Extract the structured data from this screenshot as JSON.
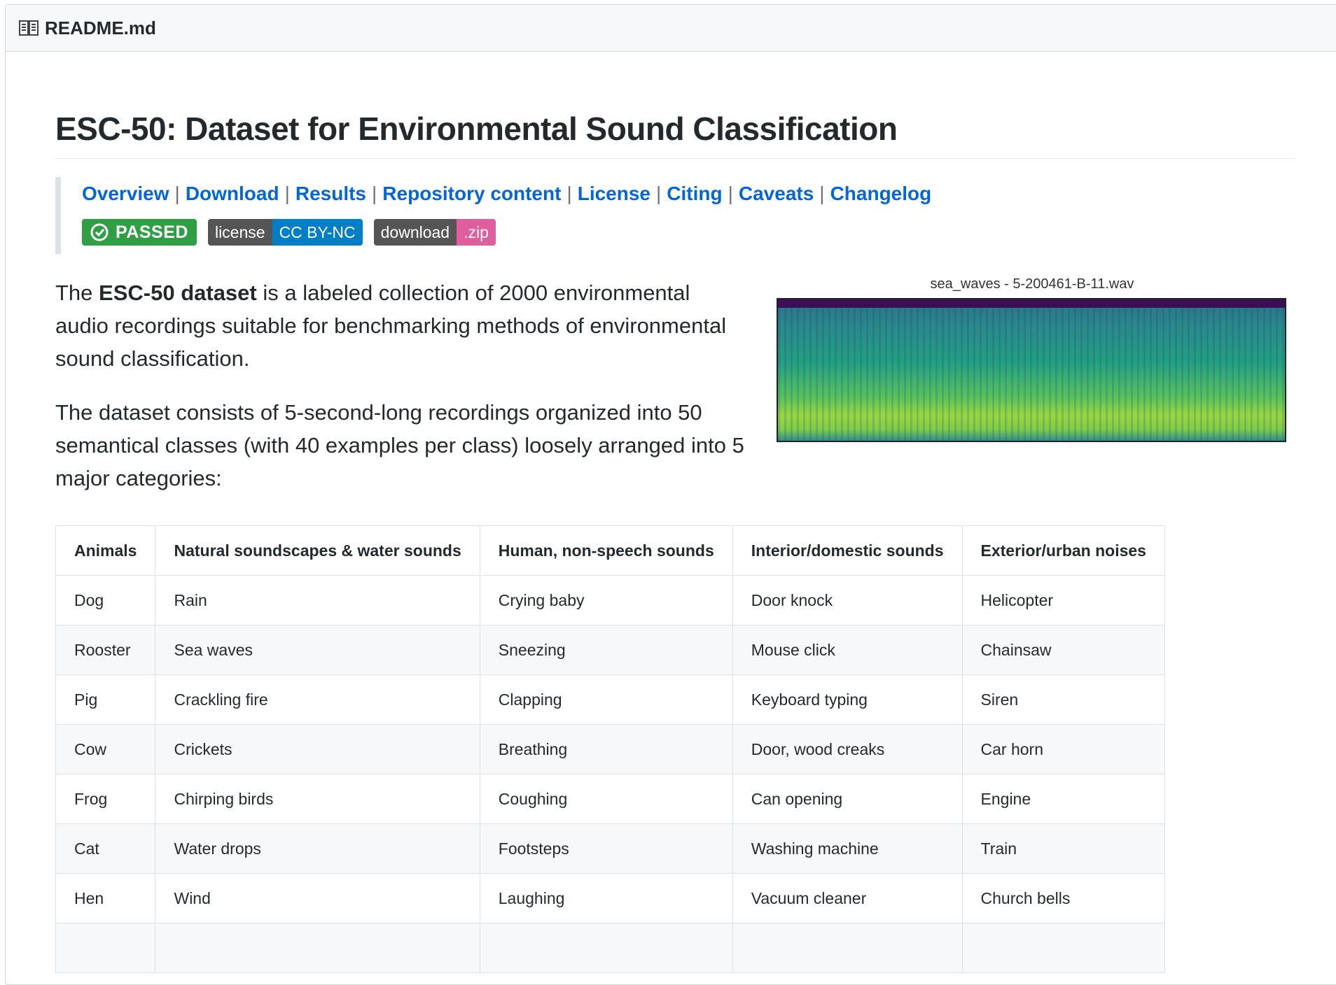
{
  "header": {
    "file_name": "README.md",
    "icon": "book-icon"
  },
  "title": "ESC-50: Dataset for Environmental Sound Classification",
  "nav": [
    "Overview",
    "Download",
    "Results",
    "Repository content",
    "License",
    "Citing",
    "Caveats",
    "Changelog"
  ],
  "nav_separator": "|",
  "badges": {
    "passed": "PASSED",
    "license_label": "license",
    "license_value": "CC BY-NC",
    "download_label": "download",
    "download_value": ".zip"
  },
  "intro": {
    "p1_prefix": "The ",
    "p1_bold": "ESC-50 dataset",
    "p1_rest": " is a labeled collection of 2000 environmental audio recordings suitable for benchmarking methods of environmental sound classification.",
    "p2": "The dataset consists of 5-second-long recordings organized into 50 semantical classes (with 40 examples per class) loosely arranged into 5 major categories:"
  },
  "spectrogram_title": "sea_waves - 5-200461-B-11.wav",
  "table": {
    "headers": [
      "Animals",
      "Natural soundscapes & water sounds",
      "Human, non-speech sounds",
      "Interior/domestic sounds",
      "Exterior/urban noises"
    ],
    "rows": [
      [
        "Dog",
        "Rain",
        "Crying baby",
        "Door knock",
        "Helicopter"
      ],
      [
        "Rooster",
        "Sea waves",
        "Sneezing",
        "Mouse click",
        "Chainsaw"
      ],
      [
        "Pig",
        "Crackling fire",
        "Clapping",
        "Keyboard typing",
        "Siren"
      ],
      [
        "Cow",
        "Crickets",
        "Breathing",
        "Door, wood creaks",
        "Car horn"
      ],
      [
        "Frog",
        "Chirping birds",
        "Coughing",
        "Can opening",
        "Engine"
      ],
      [
        "Cat",
        "Water drops",
        "Footsteps",
        "Washing machine",
        "Train"
      ],
      [
        "Hen",
        "Wind",
        "Laughing",
        "Vacuum cleaner",
        "Church bells"
      ],
      [
        "",
        "",
        "",
        "",
        ""
      ]
    ]
  }
}
